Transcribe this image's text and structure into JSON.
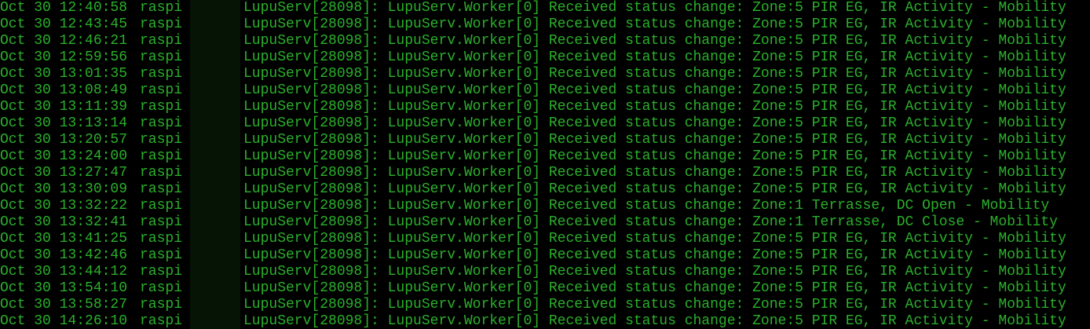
{
  "terminal": {
    "foreground": "#2bb02b",
    "background": "#000000",
    "lines": [
      {
        "timestamp": "Oct 30 12:40:58",
        "host": "raspi",
        "message": "LupuServ[28098]: LupuServ.Worker[0] Received status change: Zone:5 PIR EG, IR Activity - Mobility"
      },
      {
        "timestamp": "Oct 30 12:43:45",
        "host": "raspi",
        "message": "LupuServ[28098]: LupuServ.Worker[0] Received status change: Zone:5 PIR EG, IR Activity - Mobility"
      },
      {
        "timestamp": "Oct 30 12:46:21",
        "host": "raspi",
        "message": "LupuServ[28098]: LupuServ.Worker[0] Received status change: Zone:5 PIR EG, IR Activity - Mobility"
      },
      {
        "timestamp": "Oct 30 12:59:56",
        "host": "raspi",
        "message": "LupuServ[28098]: LupuServ.Worker[0] Received status change: Zone:5 PIR EG, IR Activity - Mobility"
      },
      {
        "timestamp": "Oct 30 13:01:35",
        "host": "raspi",
        "message": "LupuServ[28098]: LupuServ.Worker[0] Received status change: Zone:5 PIR EG, IR Activity - Mobility"
      },
      {
        "timestamp": "Oct 30 13:08:49",
        "host": "raspi",
        "message": "LupuServ[28098]: LupuServ.Worker[0] Received status change: Zone:5 PIR EG, IR Activity - Mobility"
      },
      {
        "timestamp": "Oct 30 13:11:39",
        "host": "raspi",
        "message": "LupuServ[28098]: LupuServ.Worker[0] Received status change: Zone:5 PIR EG, IR Activity - Mobility"
      },
      {
        "timestamp": "Oct 30 13:13:14",
        "host": "raspi",
        "message": "LupuServ[28098]: LupuServ.Worker[0] Received status change: Zone:5 PIR EG, IR Activity - Mobility"
      },
      {
        "timestamp": "Oct 30 13:20:57",
        "host": "raspi",
        "message": "LupuServ[28098]: LupuServ.Worker[0] Received status change: Zone:5 PIR EG, IR Activity - Mobility"
      },
      {
        "timestamp": "Oct 30 13:24:00",
        "host": "raspi",
        "message": "LupuServ[28098]: LupuServ.Worker[0] Received status change: Zone:5 PIR EG, IR Activity - Mobility"
      },
      {
        "timestamp": "Oct 30 13:27:47",
        "host": "raspi",
        "message": "LupuServ[28098]: LupuServ.Worker[0] Received status change: Zone:5 PIR EG, IR Activity - Mobility"
      },
      {
        "timestamp": "Oct 30 13:30:09",
        "host": "raspi",
        "message": "LupuServ[28098]: LupuServ.Worker[0] Received status change: Zone:5 PIR EG, IR Activity - Mobility"
      },
      {
        "timestamp": "Oct 30 13:32:22",
        "host": "raspi",
        "message": "LupuServ[28098]: LupuServ.Worker[0] Received status change: Zone:1 Terrasse, DC Open - Mobility"
      },
      {
        "timestamp": "Oct 30 13:32:41",
        "host": "raspi",
        "message": "LupuServ[28098]: LupuServ.Worker[0] Received status change: Zone:1 Terrasse, DC Close - Mobility"
      },
      {
        "timestamp": "Oct 30 13:41:25",
        "host": "raspi",
        "message": "LupuServ[28098]: LupuServ.Worker[0] Received status change: Zone:5 PIR EG, IR Activity - Mobility"
      },
      {
        "timestamp": "Oct 30 13:42:46",
        "host": "raspi",
        "message": "LupuServ[28098]: LupuServ.Worker[0] Received status change: Zone:5 PIR EG, IR Activity - Mobility"
      },
      {
        "timestamp": "Oct 30 13:44:12",
        "host": "raspi",
        "message": "LupuServ[28098]: LupuServ.Worker[0] Received status change: Zone:5 PIR EG, IR Activity - Mobility"
      },
      {
        "timestamp": "Oct 30 13:54:10",
        "host": "raspi",
        "message": "LupuServ[28098]: LupuServ.Worker[0] Received status change: Zone:5 PIR EG, IR Activity - Mobility"
      },
      {
        "timestamp": "Oct 30 13:58:27",
        "host": "raspi",
        "message": "LupuServ[28098]: LupuServ.Worker[0] Received status change: Zone:5 PIR EG, IR Activity - Mobility"
      },
      {
        "timestamp": "Oct 30 14:26:10",
        "host": "raspi",
        "message": "LupuServ[28098]: LupuServ.Worker[0] Received status change: Zone:5 PIR EG, IR Activity - Mobility"
      }
    ]
  }
}
